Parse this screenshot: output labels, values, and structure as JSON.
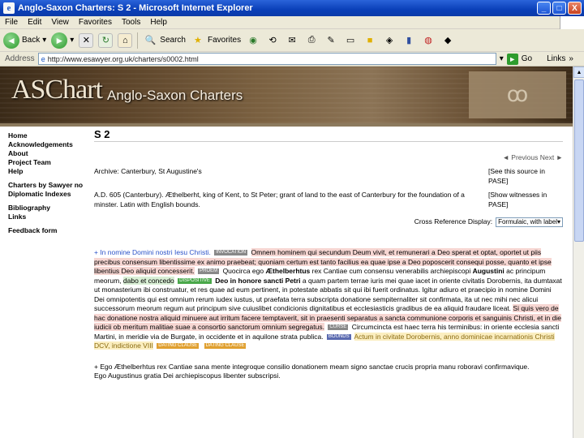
{
  "window": {
    "title": "Anglo-Saxon Charters: S 2 - Microsoft Internet Explorer",
    "controls": [
      "_",
      "□",
      "X"
    ]
  },
  "menu": [
    "File",
    "Edit",
    "View",
    "Favorites",
    "Tools",
    "Help"
  ],
  "toolbar": {
    "back_label": "Back",
    "search_label": "Search",
    "favorites_label": "Favorites"
  },
  "address": {
    "label": "Address",
    "url": "http://www.esawyer.org.uk/charters/s0002.html",
    "go_label": "Go",
    "links_label": "Links"
  },
  "banner": {
    "brand": "ASChart",
    "subtitle": "Anglo-Saxon Charters"
  },
  "sidebar": {
    "group1": [
      "Home",
      "Acknowledgements",
      "About",
      "Project Team",
      "Help"
    ],
    "group2": [
      "Charters by Sawyer no",
      "Diplomatic Indexes"
    ],
    "group3": [
      "Bibliography",
      "Links"
    ],
    "group4": [
      "Feedback form"
    ]
  },
  "content": {
    "heading": "S 2",
    "nav": "◄ Previous  Next ►",
    "archive": "Archive: Canterbury, St Augustine's",
    "archive_link": "[See this source in PASE]",
    "summary": "A.D. 605 (Canterbury). Æthelberht, king of Kent, to St Peter; grant of land to the east of Canterbury for the foundation of a minster. Latin with English bounds.",
    "summary_link": "[Show witnesses in PASE]",
    "xref_label": "Cross Reference Display:",
    "xref_value": "Formulaic, with label"
  },
  "charter": {
    "invocation": "+ In nomine Domini nostri Iesu Christi.",
    "tag_invocation": "INVOCATION",
    "proem": "Omnem hominem qui secundum Deum vivit, et remunerari a Deo sperat et optat, oportet ut piis precibus consensum libentissime ex animo praebeat; quoniam certum est tanto facilius ea quae ipse a Deo poposcerit consequi posse, quanto et ipse libentius Deo aliquid concesserit.",
    "tag_proem": "PROEM",
    "notification_pre": "Quocirca ego ",
    "king": "Æthelberhtus",
    "notification_post": " rex Cantiae cum consensu venerabilis archiepiscopi ",
    "archbishop": "Augustini",
    "notification_tail": " ac principum meorum,",
    "dispositive": "dabo et concedo",
    "tag_dispositive": "DISPOSITIVE",
    "dedication": "Deo in honore sancti Petri",
    "body": "a quam partem terrae iuris mei quae iacet in oriente civitatis Dorobernis, ita dumtaxat ut monasterium ibi construatur, et res quae ad eum pertinent, in potestate abbatis sit qui ibi fuerit ordinatus. Igitur adiuro et praecipio in nomine Domini Dei omnipotentis qui est omnium rerum iudex iustus, ut praefata terra subscripta donatione sempiternaliter sit confirmata, ita ut nec mihi nec alicui successorum meorum regum aut principum sive cuiuslibet condicionis dignitatibus et ecclesiasticis gradibus de ea aliquid fraudare liceat.",
    "sanction": "Si quis vero de hac donatione nostra aliquid minuere aut irritum facere temptaverit, sit in praesenti separatus a sancta communione corporis et sanguinis Christi, et in die iudicii ob meritum malitiae suae a consortio sanctorum omnium segregatus.",
    "tag_sanction": "CURSE",
    "bounds": "Circumcincta est haec terra his terminibus: in oriente ecclesia sancti Martini, in meridie via de Burgate, in occidente et in aquilone strata publica.",
    "tag_bounds": "BOUNDS",
    "dating": "Actum in civitate Dorobernis, anno dominicae incarnationis Christi DCV, indictione VIII",
    "tag_dating": "DATING CLAUSE",
    "tag_dating2": "DATING CLAUSE",
    "p2_line1": "+ Ego Æthelberhtus rex Cantiae sana mente integroque consilio donationem meam signo sanctae crucis propria manu roboravi confirmavique.",
    "p2_line2": "Ego Augustinus gratia Dei archiepiscopus libenter subscripsi."
  }
}
